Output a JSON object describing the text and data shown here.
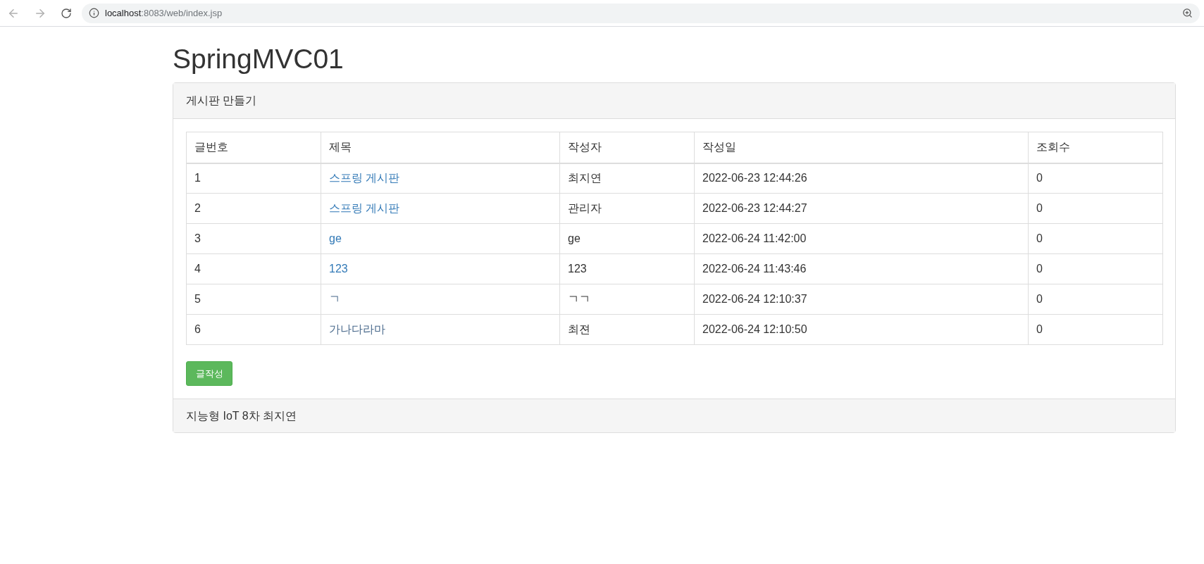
{
  "browser": {
    "url_host": "localhost",
    "url_path": ":8083/web/index.jsp"
  },
  "page_title": "SpringMVC01",
  "panel": {
    "heading": "게시판 만들기",
    "footer": "지능형 IoT 8차 최지연"
  },
  "table": {
    "columns": [
      "글번호",
      "제목",
      "작성자",
      "작성일",
      "조회수"
    ],
    "rows": [
      {
        "number": "1",
        "title": "스프링 게시판",
        "visited": false,
        "writer": "최지연",
        "date": "2022-06-23 12:44:26",
        "views": "0"
      },
      {
        "number": "2",
        "title": "스프링 게시판",
        "visited": false,
        "writer": "관리자",
        "date": "2022-06-23 12:44:27",
        "views": "0"
      },
      {
        "number": "3",
        "title": "ge",
        "visited": false,
        "writer": "ge",
        "date": "2022-06-24 11:42:00",
        "views": "0"
      },
      {
        "number": "4",
        "title": "123",
        "visited": false,
        "writer": "123",
        "date": "2022-06-24 11:43:46",
        "views": "0"
      },
      {
        "number": "5",
        "title": "ㄱ",
        "visited": true,
        "writer": "ㄱㄱ",
        "date": "2022-06-24 12:10:37",
        "views": "0"
      },
      {
        "number": "6",
        "title": "가나다라마",
        "visited": true,
        "writer": "최젼",
        "date": "2022-06-24 12:10:50",
        "views": "0"
      }
    ]
  },
  "write_button": "글작성"
}
